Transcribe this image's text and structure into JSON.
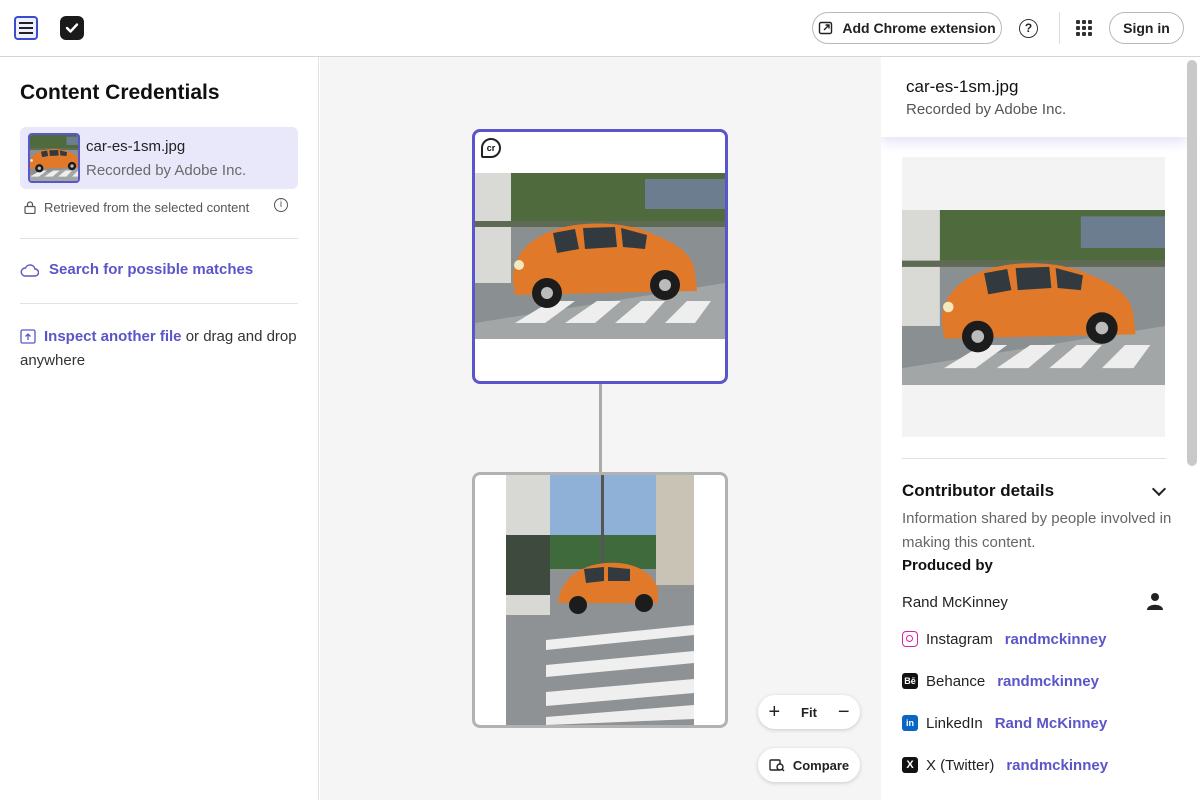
{
  "topbar": {
    "extension_button": "Add Chrome extension",
    "help_glyph": "?",
    "sign_in": "Sign in"
  },
  "left": {
    "title": "Content Credentials",
    "selected": {
      "file_name": "car-es-1sm.jpg",
      "recorded_by": "Recorded by Adobe Inc."
    },
    "retrieved_note": "Retrieved from the selected content",
    "search_link": "Search for possible matches",
    "inspect_link": "Inspect another file",
    "inspect_rest": " or drag and drop anywhere"
  },
  "canvas": {
    "badge": "cr",
    "zoom_fit": "Fit",
    "compare": "Compare"
  },
  "right": {
    "file_name": "car-es-1sm.jpg",
    "recorded_by": "Recorded by Adobe Inc.",
    "contributor_title": "Contributor details",
    "contributor_desc": "Information shared by people involved in making this content.",
    "produced_by": "Produced by",
    "person": "Rand McKinney",
    "socials": [
      {
        "platform": "Instagram",
        "handle": "randmckinney",
        "icon": "instagram-icon",
        "color": "#d6249f"
      },
      {
        "platform": "Behance",
        "handle": "randmckinney",
        "icon": "behance-icon",
        "color": "#111111"
      },
      {
        "platform": "LinkedIn",
        "handle": "Rand McKinney",
        "icon": "linkedin-icon",
        "color": "#0a66c2"
      },
      {
        "platform": "X (Twitter)",
        "handle": "randmckinney",
        "icon": "x-twitter-icon",
        "color": "#111111"
      }
    ]
  },
  "colors": {
    "accent": "#5a55c9",
    "selected_bg": "#e9e8fb",
    "car_orange": "#e07a2a"
  }
}
